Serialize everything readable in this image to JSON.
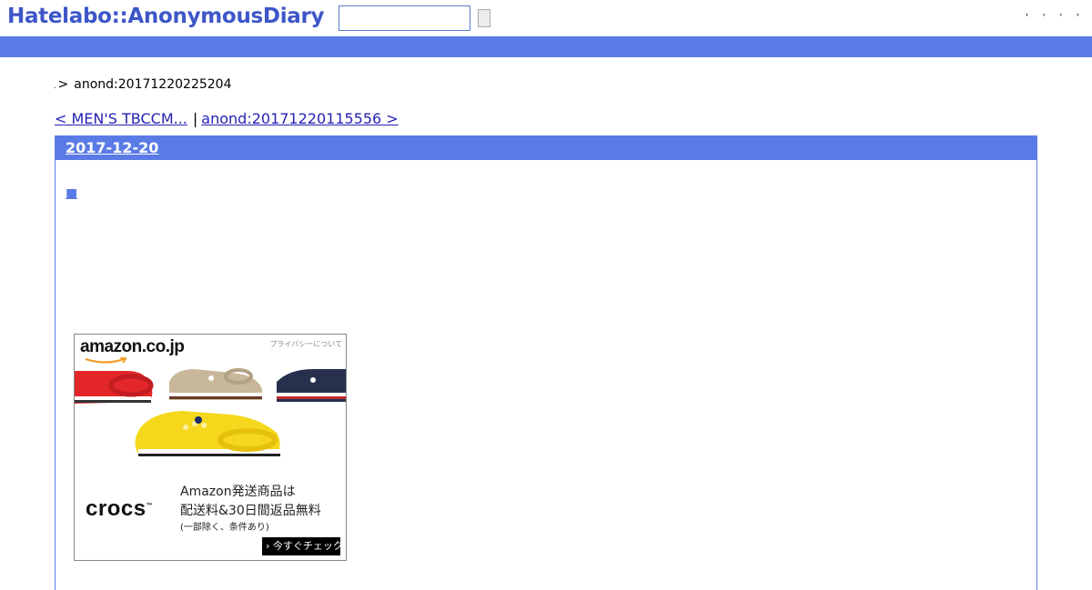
{
  "header": {
    "logo": "Hatelabo::AnonymousDiary",
    "search_value": "",
    "links": [
      "'",
      "'",
      "'",
      "'"
    ]
  },
  "breadcrumb": {
    "home": ".",
    "arrow": ">",
    "current": "anond:20171220225204"
  },
  "pager": {
    "prev": "< MEN'S TBCCM...",
    "separator": "|",
    "next": "anond:20171220115556 >"
  },
  "day": {
    "date": "2017-12-20",
    "entry_marker": "■"
  },
  "ad": {
    "logo": "amazon.co.jp",
    "privacy": "プライバシーについて",
    "brand": "crocs",
    "brand_tm": "™",
    "copy_line1": "Amazon発送商品は",
    "copy_line2": "配送料&30日間返品無料",
    "copy_line3": "(一部除く、条件あり)",
    "cta": "› 今すぐチェック",
    "colors": {
      "red": "#e3262a",
      "tan": "#c9b79b",
      "navy": "#27314d",
      "yellow": "#f5d81c"
    }
  },
  "colors": {
    "accent": "#5a7be5",
    "logo": "#3d56c8",
    "link": "#2323b5"
  }
}
